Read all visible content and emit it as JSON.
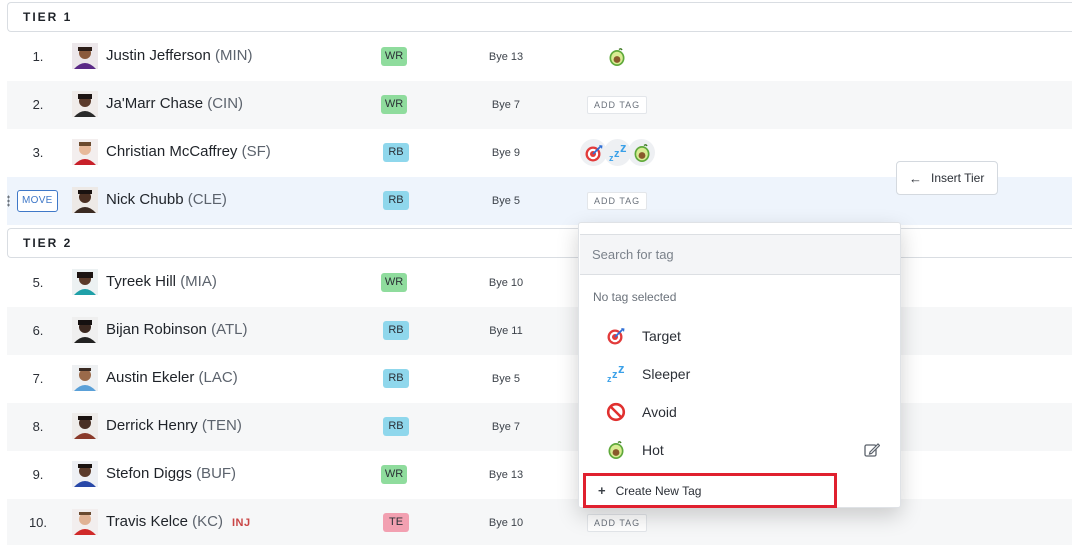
{
  "tiers": [
    {
      "label": "TIER 1"
    },
    {
      "label": "TIER 2"
    }
  ],
  "players": [
    {
      "rank": "1.",
      "name": "Justin Jefferson",
      "team": "(MIN)",
      "pos": "WR",
      "bye": "Bye 13",
      "tags": [
        "avocado"
      ],
      "add_tag": ""
    },
    {
      "rank": "2.",
      "name": "Ja'Marr Chase",
      "team": "(CIN)",
      "pos": "WR",
      "bye": "Bye 7",
      "tags": [],
      "add_tag": "ADD TAG"
    },
    {
      "rank": "3.",
      "name": "Christian McCaffrey",
      "team": "(SF)",
      "pos": "RB",
      "bye": "Bye 9",
      "tags": [
        "target",
        "sleeper",
        "avocado"
      ],
      "add_tag": ""
    },
    {
      "rank": "",
      "name": "Nick Chubb",
      "team": "(CLE)",
      "pos": "RB",
      "bye": "Bye 5",
      "tags": [],
      "add_tag": "ADD TAG",
      "move_label": "MOVE"
    },
    {
      "rank": "5.",
      "name": "Tyreek Hill",
      "team": "(MIA)",
      "pos": "WR",
      "bye": "Bye 10"
    },
    {
      "rank": "6.",
      "name": "Bijan Robinson",
      "team": "(ATL)",
      "pos": "RB",
      "bye": "Bye 11"
    },
    {
      "rank": "7.",
      "name": "Austin Ekeler",
      "team": "(LAC)",
      "pos": "RB",
      "bye": "Bye 5"
    },
    {
      "rank": "8.",
      "name": "Derrick Henry",
      "team": "(TEN)",
      "pos": "RB",
      "bye": "Bye 7"
    },
    {
      "rank": "9.",
      "name": "Stefon Diggs",
      "team": "(BUF)",
      "pos": "WR",
      "bye": "Bye 13"
    },
    {
      "rank": "10.",
      "name": "Travis Kelce",
      "team": "(KC)",
      "pos": "TE",
      "bye": "Bye 10",
      "injury": "INJ",
      "add_tag": "ADD TAG"
    }
  ],
  "insert_tier": {
    "label": "Insert Tier"
  },
  "tag_dropdown": {
    "search_placeholder": "Search for tag",
    "no_tag_text": "No tag selected",
    "options": [
      {
        "label": "Target",
        "icon": "target-icon"
      },
      {
        "label": "Sleeper",
        "icon": "sleeper-icon"
      },
      {
        "label": "Avoid",
        "icon": "avoid-icon"
      },
      {
        "label": "Hot",
        "icon": "avocado-icon"
      }
    ],
    "create_label": "Create New Tag"
  },
  "colors": {
    "wr": "#8fdc9d",
    "rb": "#8fd7ec",
    "te": "#f2a0b1",
    "accent": "#3f78c8",
    "highlight_box": "#e0202f",
    "injury": "#c94545"
  }
}
